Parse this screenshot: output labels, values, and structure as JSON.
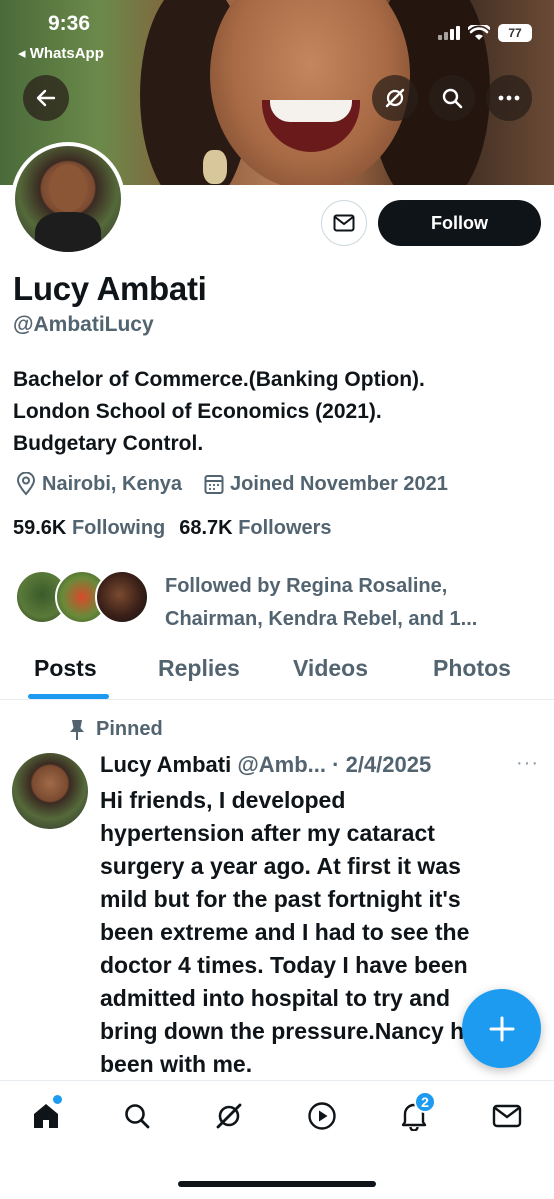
{
  "status_bar": {
    "time": "9:36",
    "back_app": "◂ WhatsApp",
    "battery": "77"
  },
  "header": {
    "back_icon": "arrow-left-icon",
    "actions": [
      "grok-icon",
      "search-icon",
      "more-icon"
    ]
  },
  "profile": {
    "name": "Lucy Ambati",
    "handle": "@AmbatiLucy",
    "follow_label": "Follow",
    "bio_lines": [
      "Bachelor of Commerce.(Banking Option).",
      "London School of Economics (2021).",
      "Budgetary Control."
    ],
    "location": "Nairobi, Kenya",
    "joined": "Joined November 2021",
    "following_count": "59.6K",
    "following_label": "Following",
    "followers_count": "68.7K",
    "followers_label": "Followers",
    "followed_by_lines": [
      "Followed by Regina Rosaline,",
      "Chairman, Kendra Rebel, and 1..."
    ]
  },
  "tabs": [
    "Posts",
    "Replies",
    "Videos",
    "Photos"
  ],
  "active_tab": "Posts",
  "post": {
    "pinned_label": "Pinned",
    "author": "Lucy Ambati",
    "handle_short": "@Amb...",
    "date": "· 2/4/2025",
    "more": "···",
    "lines": [
      "Hi friends, I developed",
      "hypertension after my cataract",
      "surgery a year ago. At first it was",
      "mild but for the past fortnight it's",
      "been extreme and I had to see the",
      "doctor 4 times. Today I have been",
      "admitted into hospital to try and",
      "bring down the pressure.Nancy has",
      "been with me."
    ]
  },
  "bottom_nav": {
    "items": [
      "home-icon",
      "search-icon",
      "grok-icon",
      "play-icon",
      "bell-icon",
      "mail-icon"
    ],
    "notification_count": "2"
  },
  "colors": {
    "accent": "#1d9bf0",
    "text": "#0f1419",
    "muted": "#536471"
  }
}
